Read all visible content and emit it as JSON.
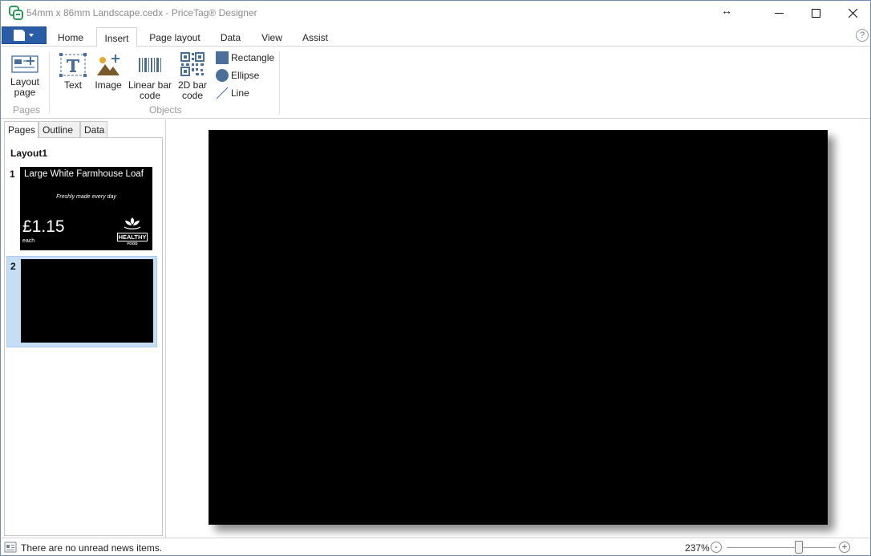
{
  "window": {
    "title": "54mm x 86mm Landscape.cedx - PriceTag® Designer",
    "resize_glyph": "↔"
  },
  "ribbon_tabs": [
    {
      "label": "Home"
    },
    {
      "label": "Insert",
      "active": true
    },
    {
      "label": "Page layout"
    },
    {
      "label": "Data"
    },
    {
      "label": "View"
    },
    {
      "label": "Assist"
    }
  ],
  "help": "?",
  "ribbon": {
    "pages_group": {
      "label": "Pages",
      "layout_page": "Layout page"
    },
    "objects_group": {
      "label": "Objects",
      "text": "Text",
      "image": "Image",
      "linear_bar_code": "Linear bar code",
      "bar_code_2d": "2D bar code",
      "rectangle": "Rectangle",
      "ellipse": "Ellipse",
      "line": "Line"
    }
  },
  "left_panel": {
    "tabs": [
      {
        "label": "Pages",
        "active": true
      },
      {
        "label": "Outline"
      },
      {
        "label": "Data"
      }
    ],
    "layout_name": "Layout1",
    "pages": [
      {
        "number": "1",
        "product_name": "Large White Farmhouse Loaf",
        "tagline": "Freshly made every day",
        "price": "£1.15",
        "unit": "each",
        "logo_text": "HEALTHY",
        "logo_subtext": "FOOD"
      },
      {
        "number": "2",
        "selected": true
      }
    ]
  },
  "status": {
    "news": "There are no unread news items.",
    "zoom": "237%",
    "zoom_minus": "-",
    "zoom_plus": "+"
  },
  "colors": {
    "file_button": "#2a5ca8",
    "icon_blue": "#4a6f9a",
    "selection": "#c5def5",
    "label_background": "#000000"
  }
}
